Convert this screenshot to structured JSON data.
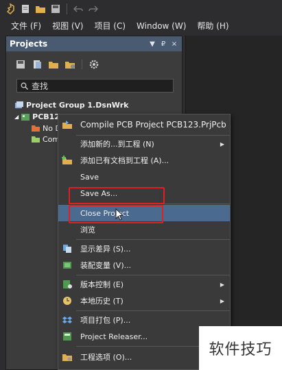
{
  "menubar": {
    "items": [
      "文件 (F)",
      "视图 (V)",
      "项目 (C)",
      "Window (W)",
      "帮助 (H)"
    ]
  },
  "panel": {
    "title": "Projects",
    "controls": [
      "▼",
      "₽",
      "×"
    ],
    "search_text": "查找",
    "tree": {
      "group": "Project Group 1.DsnWrk",
      "project": "PCB123",
      "children": [
        "No D",
        "Com"
      ]
    }
  },
  "context_menu": {
    "items": [
      {
        "label": "Compile PCB Project PCB123.PrjPcb",
        "icon": "compile-icon"
      },
      {
        "label": "添加新的...到工程 (N)",
        "icon": "",
        "submenu": true
      },
      {
        "label": "添加已有文档到工程 (A)...",
        "icon": "add-existing-icon"
      },
      {
        "label": "Save",
        "icon": ""
      },
      {
        "label": "Save As...",
        "icon": ""
      },
      {
        "label": "Close Project",
        "icon": ""
      },
      {
        "label": "浏览",
        "icon": ""
      },
      {
        "label": "显示差异 (S)...",
        "icon": "diff-icon"
      },
      {
        "label": "装配变量 (V)...",
        "icon": "variant-icon"
      },
      {
        "label": "版本控制 (E)",
        "icon": "version-control-icon",
        "submenu": true
      },
      {
        "label": "本地历史 (T)",
        "icon": "history-icon",
        "submenu": true
      },
      {
        "label": "项目打包 (P)...",
        "icon": "dropbox-icon"
      },
      {
        "label": "Project Releaser...",
        "icon": "releaser-icon"
      },
      {
        "label": "工程选项 (O)...",
        "icon": "options-icon"
      }
    ],
    "highlighted": "Close Project"
  },
  "watermark": "软件技巧",
  "colors": {
    "panel_header": "#4a5b71",
    "highlight": "#4b6a8f",
    "annotation_box": "#e02020"
  }
}
